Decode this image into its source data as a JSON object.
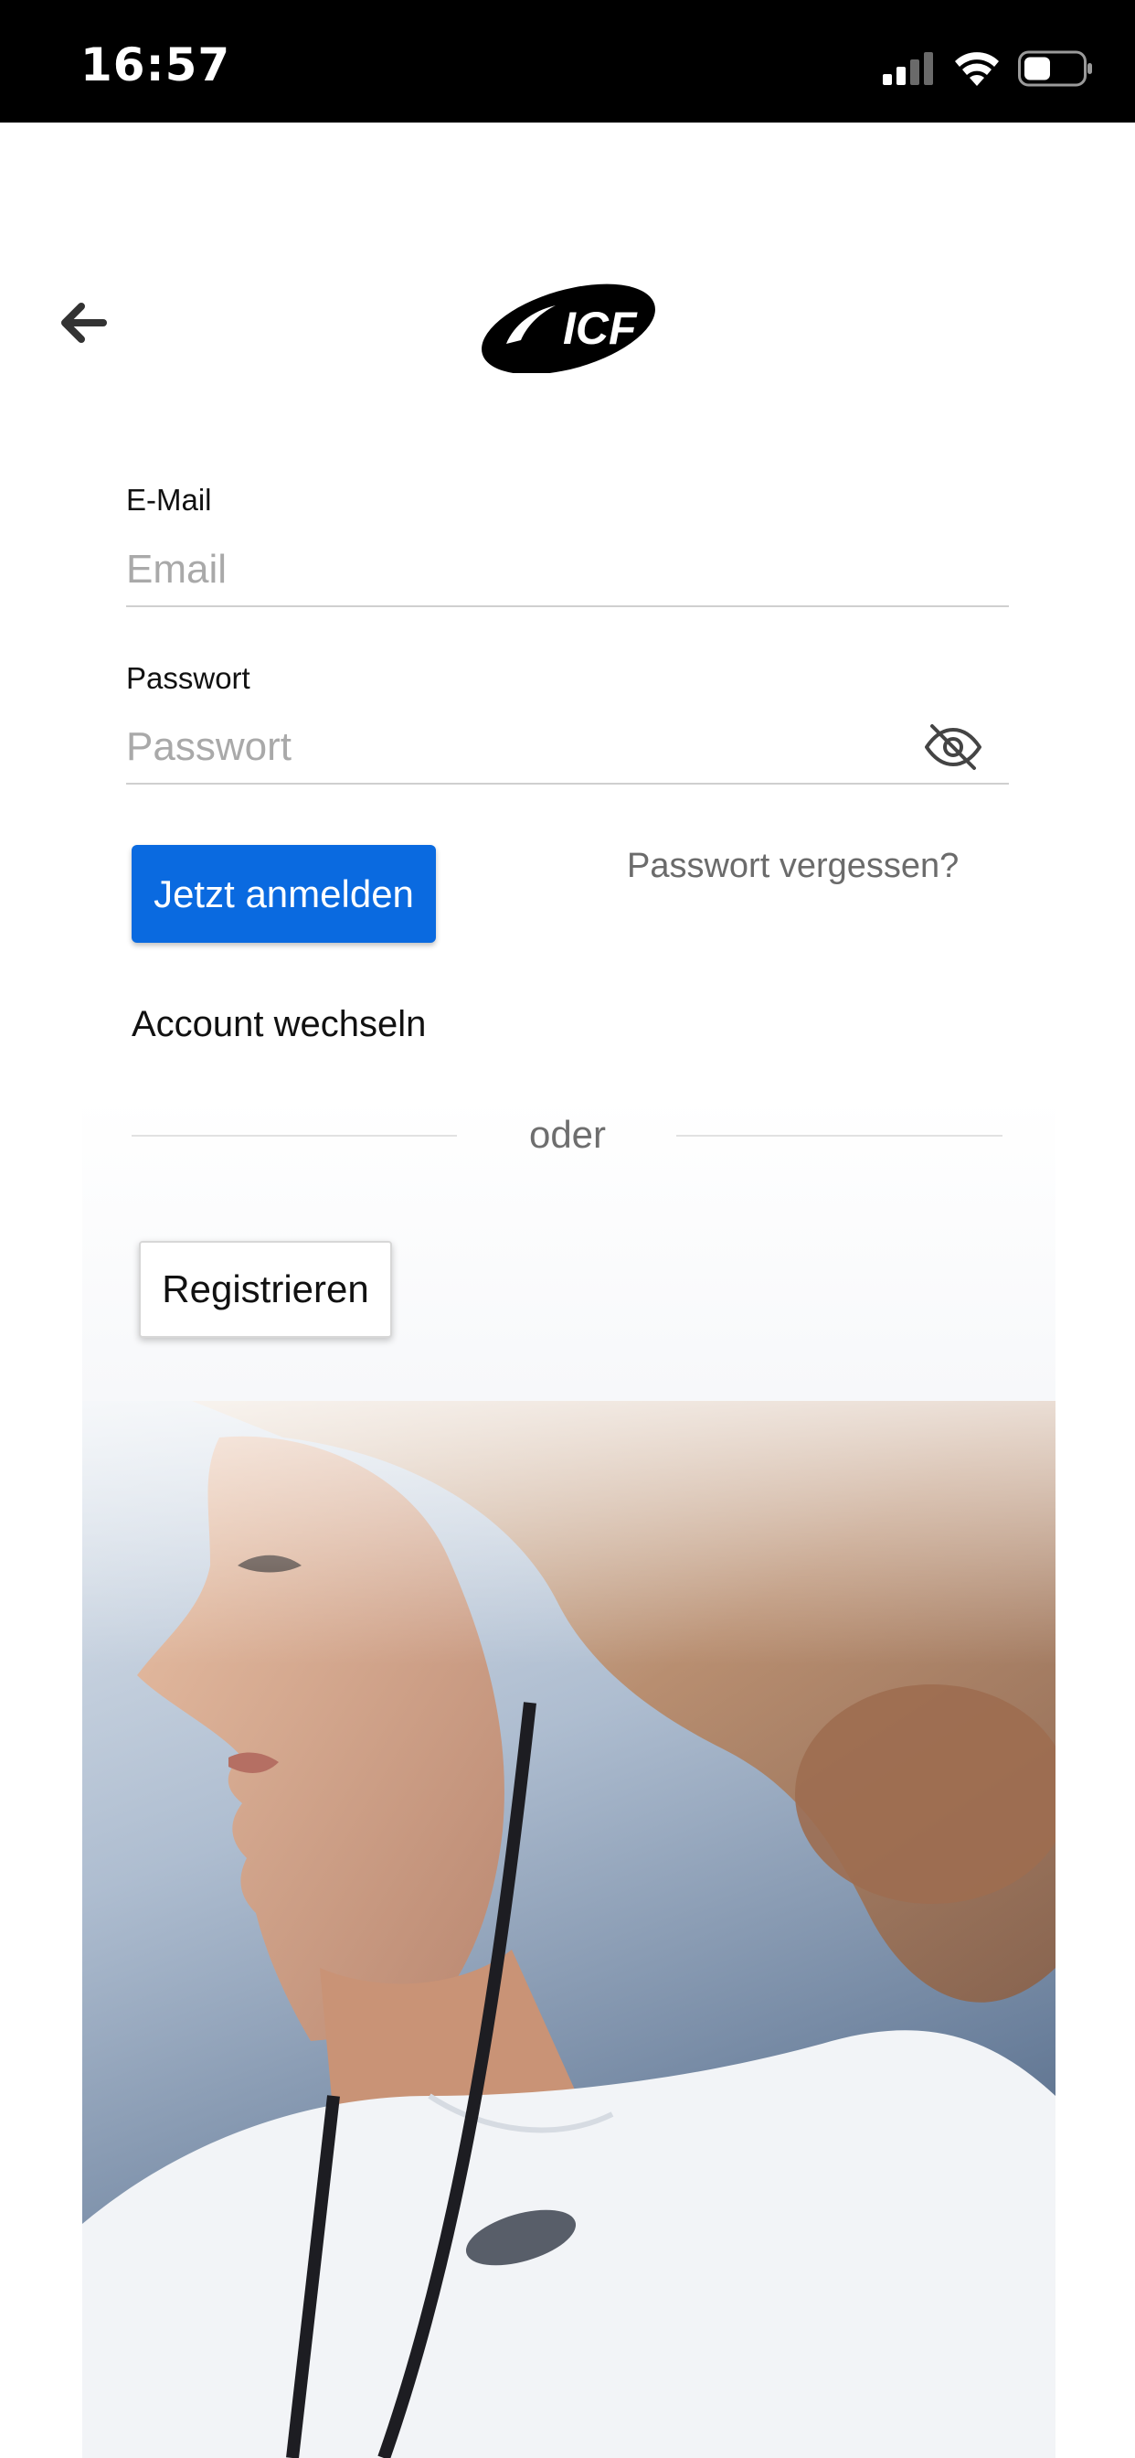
{
  "status_bar": {
    "time": "16:57",
    "icons": [
      "cellular-signal-icon",
      "wifi-icon",
      "battery-icon"
    ]
  },
  "header": {
    "back_icon": "arrow-left-icon",
    "logo_text": "ICF"
  },
  "form": {
    "email": {
      "label": "E-Mail",
      "placeholder": "Email",
      "value": ""
    },
    "password": {
      "label": "Passwort",
      "placeholder": "Passwort",
      "value": "",
      "toggle_icon": "eye-off-icon"
    },
    "login_button": "Jetzt anmelden",
    "forgot_password": "Passwort vergessen?",
    "switch_account": "Account wechseln",
    "divider": "oder",
    "register_button": "Registrieren"
  },
  "colors": {
    "primary": "#0a6ae0",
    "status_bar": "#000000",
    "muted_text": "#6b6b6b",
    "placeholder": "#a9a9a9"
  }
}
